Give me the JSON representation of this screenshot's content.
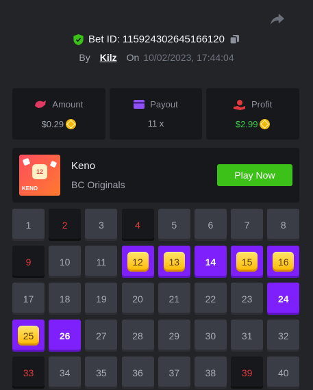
{
  "bet": {
    "label": "Bet ID:",
    "id": "115924302645166120"
  },
  "byline": {
    "by": "By",
    "user": "Kilz",
    "on": "On",
    "date": "10/02/2023, 17:44:04"
  },
  "stats": [
    {
      "label": "Amount",
      "value": "$0.29",
      "coin": true,
      "color": "#9ea3ad"
    },
    {
      "label": "Payout",
      "value": "11 x",
      "coin": false,
      "color": "#9ea3ad"
    },
    {
      "label": "Profit",
      "value": "$2.99",
      "coin": true,
      "color": "#3bd149"
    }
  ],
  "game": {
    "title": "Keno",
    "subtitle": "BC Originals",
    "play_label": "Play Now",
    "thumb_ball": "12",
    "thumb_label": "KENO"
  },
  "cells": [
    {
      "n": "1",
      "s": "normal"
    },
    {
      "n": "2",
      "s": "drawn"
    },
    {
      "n": "3",
      "s": "normal"
    },
    {
      "n": "4",
      "s": "drawn"
    },
    {
      "n": "5",
      "s": "normal"
    },
    {
      "n": "6",
      "s": "normal"
    },
    {
      "n": "7",
      "s": "normal"
    },
    {
      "n": "8",
      "s": "normal"
    },
    {
      "n": "9",
      "s": "drawn"
    },
    {
      "n": "10",
      "s": "normal"
    },
    {
      "n": "11",
      "s": "normal"
    },
    {
      "n": "12",
      "s": "hit"
    },
    {
      "n": "13",
      "s": "hit"
    },
    {
      "n": "14",
      "s": "picked"
    },
    {
      "n": "15",
      "s": "hit"
    },
    {
      "n": "16",
      "s": "hit"
    },
    {
      "n": "17",
      "s": "normal"
    },
    {
      "n": "18",
      "s": "normal"
    },
    {
      "n": "19",
      "s": "normal"
    },
    {
      "n": "20",
      "s": "normal"
    },
    {
      "n": "21",
      "s": "normal"
    },
    {
      "n": "22",
      "s": "normal"
    },
    {
      "n": "23",
      "s": "normal"
    },
    {
      "n": "24",
      "s": "picked"
    },
    {
      "n": "25",
      "s": "hit"
    },
    {
      "n": "26",
      "s": "picked"
    },
    {
      "n": "27",
      "s": "normal"
    },
    {
      "n": "28",
      "s": "normal"
    },
    {
      "n": "29",
      "s": "normal"
    },
    {
      "n": "30",
      "s": "normal"
    },
    {
      "n": "31",
      "s": "normal"
    },
    {
      "n": "32",
      "s": "normal"
    },
    {
      "n": "33",
      "s": "drawn"
    },
    {
      "n": "34",
      "s": "normal"
    },
    {
      "n": "35",
      "s": "normal"
    },
    {
      "n": "36",
      "s": "normal"
    },
    {
      "n": "37",
      "s": "normal"
    },
    {
      "n": "38",
      "s": "normal"
    },
    {
      "n": "39",
      "s": "drawn"
    },
    {
      "n": "40",
      "s": "normal"
    }
  ]
}
